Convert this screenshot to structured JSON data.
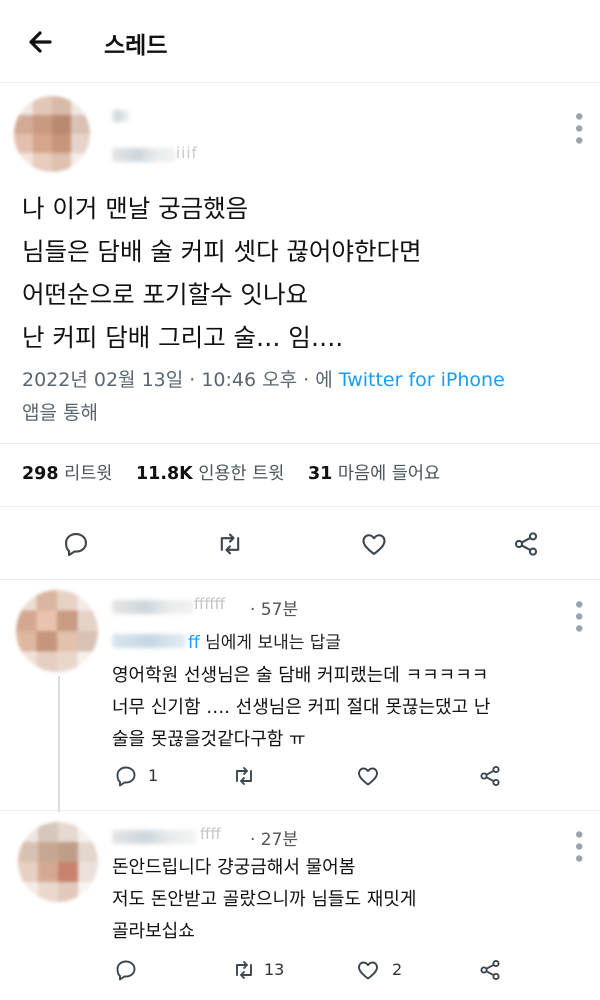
{
  "header": {
    "title": "스레드"
  },
  "tweet": {
    "text": "나 이거 맨날 궁금했음\n님들은 담배 술 커피 셋다 끊어야한다면\n어떤순으로 포기할수 잇나요\n난 커피 담배 그리고 술… 임….",
    "date": "2022년 02월 13일 · 10:46 오후 · 에 ",
    "source": "Twitter for iPhone",
    "via": "앱을 통해",
    "retweets": "298",
    "retweets_label": "리트윗",
    "quotes": "11.8K",
    "quotes_label": "인용한 트윗",
    "likes": "31",
    "likes_label": "마음에 들어요",
    "handle_fragment": "iiif"
  },
  "replies": [
    {
      "name_fragment": "ffffff",
      "time": "· 57분",
      "reply_to_fragment": "ff",
      "reply_to": "님에게 보내는 답글",
      "text": "영어학원 선생님은 술 담배 커피랬는데 ㅋㅋㅋㅋㅋ\n너무 신기함 …. 선생님은 커피 절대 못끊는댔고 난\n술을 못끊을것같다구함 ㅠ",
      "reply_count": "1",
      "retweet_count": "",
      "like_count": ""
    },
    {
      "name_fragment": "ffff",
      "time": "· 27분",
      "text": "돈안드립니다 걍궁금해서 물어봄\n저도 돈안받고 골랐으니까 님들도 재밋게\n골라보십쇼",
      "reply_count": "",
      "retweet_count": "13",
      "like_count": "2"
    }
  ],
  "colors": {
    "accent": "#1d9bf0",
    "icon": "#3c464f",
    "divider": "#ececec"
  },
  "icons": [
    "back-arrow-icon",
    "more-icon",
    "reply-icon",
    "retweet-icon",
    "like-icon",
    "share-icon"
  ]
}
